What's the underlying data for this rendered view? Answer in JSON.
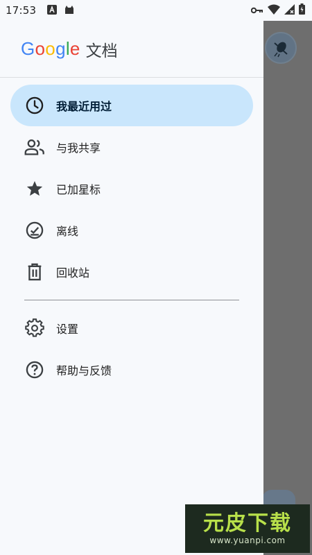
{
  "status_bar": {
    "time": "17:53",
    "icons_left": [
      "text-a-icon",
      "android-cat-icon"
    ],
    "icons_right": [
      "vpn-key-icon",
      "wifi-icon",
      "signal-icon",
      "battery-icon"
    ]
  },
  "header": {
    "logo_letters": [
      {
        "char": "G",
        "color": "#4285F4"
      },
      {
        "char": "o",
        "color": "#EA4335"
      },
      {
        "char": "o",
        "color": "#FBBC05"
      },
      {
        "char": "g",
        "color": "#4285F4"
      },
      {
        "char": "l",
        "color": "#34A853"
      },
      {
        "char": "e",
        "color": "#EA4335"
      }
    ],
    "app_title": "文档"
  },
  "nav": {
    "items": [
      {
        "label": "我最近用过",
        "icon": "clock-icon",
        "active": true
      },
      {
        "label": "与我共享",
        "icon": "people-icon",
        "active": false
      },
      {
        "label": "已加星标",
        "icon": "star-icon",
        "active": false
      },
      {
        "label": "离线",
        "icon": "offline-check-icon",
        "active": false
      },
      {
        "label": "回收站",
        "icon": "trash-icon",
        "active": false
      }
    ],
    "secondary": [
      {
        "label": "设置",
        "icon": "gear-icon"
      },
      {
        "label": "帮助与反馈",
        "icon": "help-icon"
      }
    ]
  },
  "watermark": {
    "text": "元皮下载",
    "url": "www.yuanpi.com"
  },
  "colors": {
    "active_bg": "#c9e6fc",
    "drawer_bg": "#f7f9fc",
    "scrim": "#6f6f6f"
  }
}
